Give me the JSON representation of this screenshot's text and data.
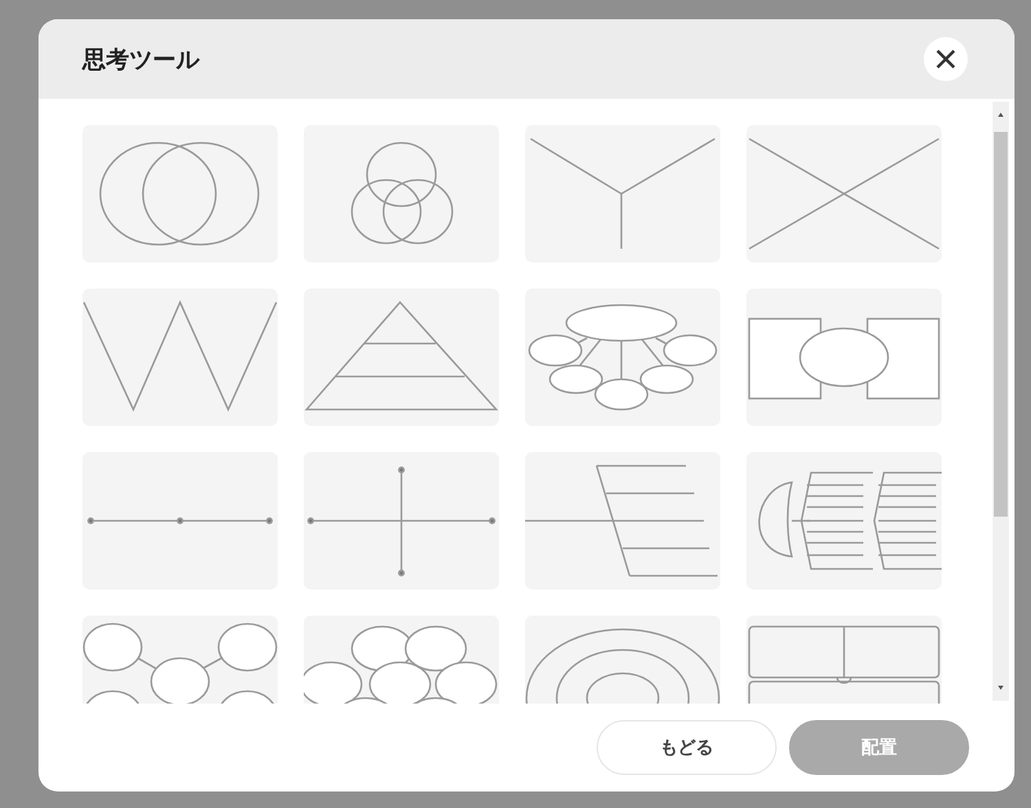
{
  "dialog": {
    "title": "思考ツール",
    "tools": [
      {
        "kind": "venn2"
      },
      {
        "kind": "venn3"
      },
      {
        "kind": "y_chart"
      },
      {
        "kind": "x_chart"
      },
      {
        "kind": "w_chart"
      },
      {
        "kind": "pyramid"
      },
      {
        "kind": "web"
      },
      {
        "kind": "bridge"
      },
      {
        "kind": "line"
      },
      {
        "kind": "cross"
      },
      {
        "kind": "fishbone"
      },
      {
        "kind": "fishbone_double"
      },
      {
        "kind": "bubble_chain"
      },
      {
        "kind": "bubble_cluster"
      },
      {
        "kind": "concentric"
      },
      {
        "kind": "table"
      }
    ],
    "buttons": [
      {
        "label": "もどる",
        "disabled": false
      },
      {
        "label": "配置",
        "disabled": true
      }
    ]
  }
}
